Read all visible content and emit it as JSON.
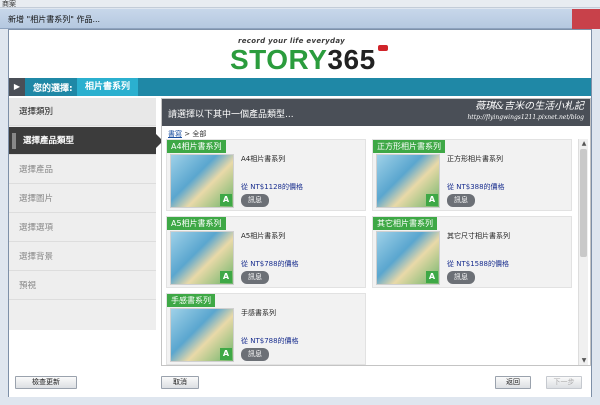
{
  "top_strip": "商案",
  "window": {
    "title": "新增 \"相片書系列\" 作品..."
  },
  "header": {
    "tagline": "record your life everyday",
    "logo_text": "STORY",
    "logo_num": "365"
  },
  "crumb": {
    "label": "您的選擇:",
    "value": "相片書系列"
  },
  "sidebar": {
    "items": [
      {
        "label": "選擇類別"
      },
      {
        "label": "選擇產品類型"
      },
      {
        "label": "選擇產品"
      },
      {
        "label": "選擇圖片"
      },
      {
        "label": "選擇選項"
      },
      {
        "label": "選擇背景"
      },
      {
        "label": "預視"
      }
    ]
  },
  "main": {
    "heading": "請選擇以下其中一個產品類型...",
    "watermark": "薇琪&吉米の生活小札記",
    "watermark_url": "http://flyingwings1211.pixnet.net/blog",
    "subcrumb_link": "書寫",
    "subcrumb_rest": " > 全部"
  },
  "products": [
    {
      "badge": "A4相片書系列",
      "name": "A4相片書系列",
      "price": "從 NT$1128的價格",
      "info": "訊息"
    },
    {
      "badge": "正方形相片書系列",
      "name": "正方形相片書系列",
      "price": "從 NT$388的價格",
      "info": "訊息"
    },
    {
      "badge": "A5相片書系列",
      "name": "A5相片書系列",
      "price": "從 NT$788的價格",
      "info": "訊息"
    },
    {
      "badge": "其它相片書系列",
      "name": "其它尺寸相片書系列",
      "price": "從 NT$1588的價格",
      "info": "訊息"
    },
    {
      "badge": "手感書系列",
      "name": "手感書系列",
      "price": "從 NT$788的價格",
      "info": "訊息"
    }
  ],
  "footer": {
    "update": "檢查更新",
    "cancel": "取消",
    "back": "返回",
    "next": "下一步"
  }
}
